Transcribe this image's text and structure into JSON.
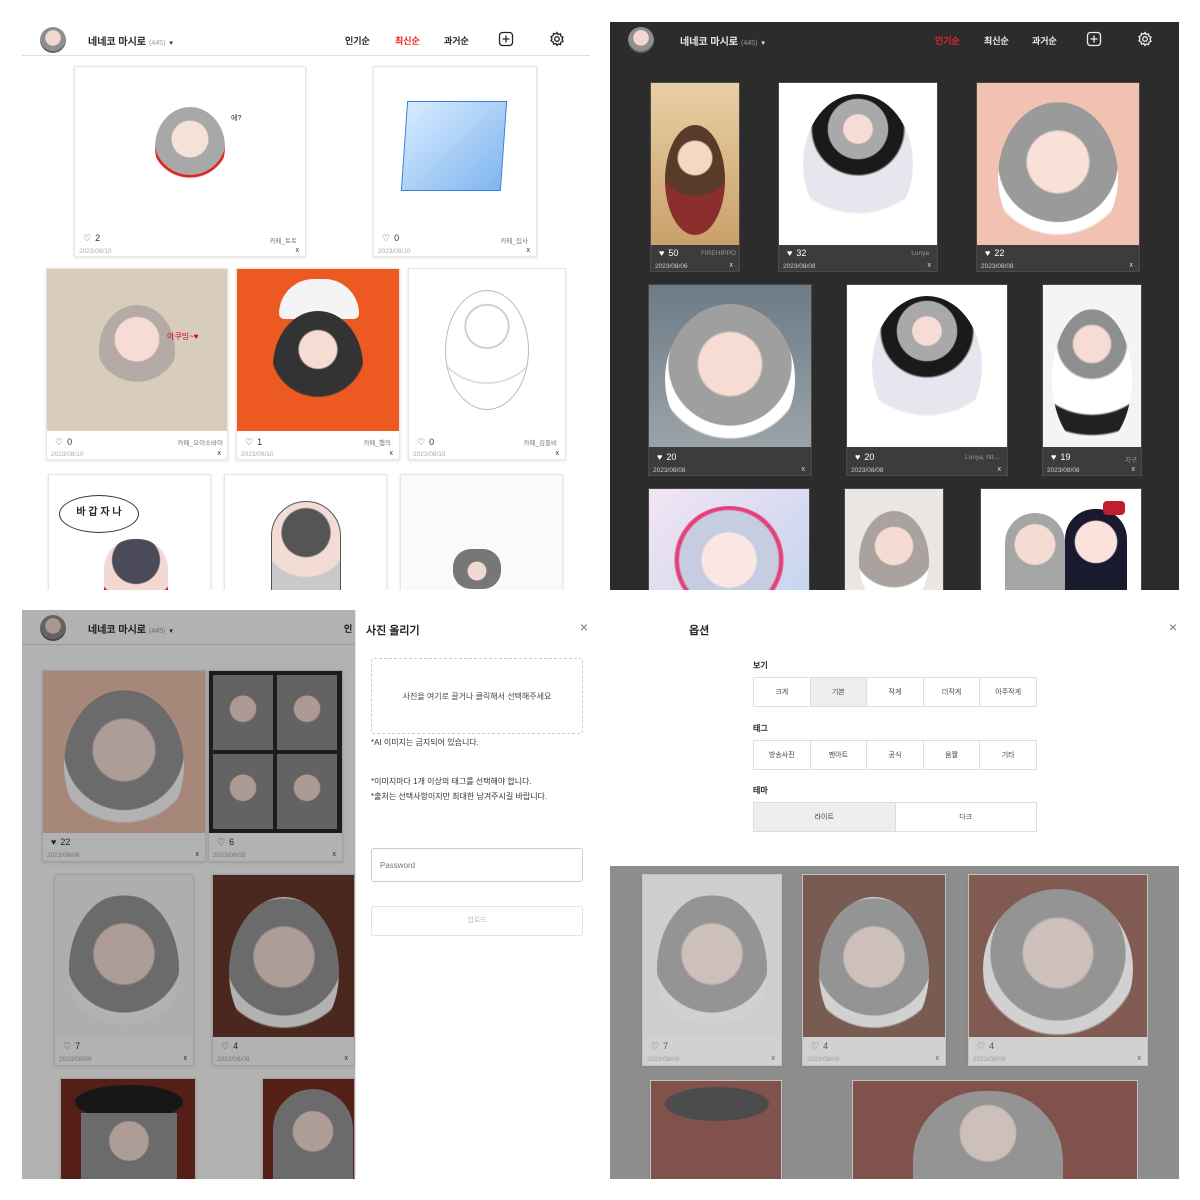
{
  "header": {
    "username": "네네코 마시로",
    "count": "(445)",
    "caret": "▾",
    "tabs": [
      "인기순",
      "최신순",
      "과거순"
    ]
  },
  "light_feed": {
    "active_tab": "최신순",
    "cards": [
      {
        "likes": "2",
        "date": "2023/08/10",
        "author": "카페_토토",
        "close": "x"
      },
      {
        "likes": "0",
        "date": "2023/08/10",
        "author": "카페_집사",
        "close": "x"
      },
      {
        "likes": "0",
        "date": "2023/08/10",
        "author": "카페_오이소바이",
        "close": "x"
      },
      {
        "likes": "1",
        "date": "2023/08/10",
        "author": "카페_햄의",
        "close": "x"
      },
      {
        "likes": "0",
        "date": "2023/08/10",
        "author": "카페_김들비",
        "close": "x"
      }
    ],
    "art_text": {
      "bubble_a": "에?",
      "bubble_b": "아쿠밍~♥",
      "bubble_c": "바 갑 자 나"
    }
  },
  "dark_feed": {
    "active_tab": "인기순",
    "cards": [
      {
        "likes": "50",
        "date": "2023/08/06",
        "author": "FIREHIPPO",
        "close": "x"
      },
      {
        "likes": "32",
        "date": "2023/08/08",
        "author": "Lunya",
        "close": "x"
      },
      {
        "likes": "22",
        "date": "2023/08/08",
        "author": "",
        "close": "x"
      },
      {
        "likes": "20",
        "date": "2023/08/08",
        "author": "",
        "close": "x"
      },
      {
        "likes": "20",
        "date": "2023/08/08",
        "author": "Lunya, htt...",
        "close": "x"
      },
      {
        "likes": "19",
        "date": "2023/08/08",
        "author": "지구",
        "close": "x"
      }
    ]
  },
  "upload_screen": {
    "partial_tab": "인",
    "background_cards": [
      {
        "likes": "22",
        "date": "2023/08/08",
        "close": "x"
      },
      {
        "likes": "6",
        "date": "2023/08/08",
        "close": "x"
      },
      {
        "likes": "7",
        "date": "2023/08/08",
        "close": "x"
      },
      {
        "likes": "4",
        "date": "2023/08/08",
        "close": "x"
      }
    ],
    "panel": {
      "title": "사진 올리기",
      "close": "×",
      "dropzone": "사진을 여기로 끌거나 클릭해서 선택해주세요",
      "note_ai": "*AI 이미지는 금지되어 있습니다.",
      "note_tag": "*이미지마다 1개 이상의 태그를 선택해야 합니다.",
      "note_source": "*출처는 선택사항이지만 최대한 남겨주시길 바랍니다.",
      "password_placeholder": "Password",
      "upload_button": "업로드"
    }
  },
  "options_screen": {
    "title": "옵션",
    "close": "×",
    "view_label": "보기",
    "view_options": [
      "크게",
      "기본",
      "작게",
      "더작게",
      "아주작게"
    ],
    "view_selected": "기본",
    "tag_label": "태그",
    "tag_options": [
      "방송사진",
      "팬아트",
      "공식",
      "움짤",
      "기타"
    ],
    "theme_label": "테마",
    "theme_options": [
      "라이트",
      "다크"
    ],
    "theme_selected": "라이트",
    "background_cards": [
      {
        "likes": "7",
        "date": "2023/08/08",
        "close": "x"
      },
      {
        "likes": "4",
        "date": "2023/08/08",
        "close": "x"
      },
      {
        "likes": "4",
        "date": "2023/08/08",
        "close": "x"
      }
    ]
  },
  "colors": {
    "accent": "#ee2222",
    "dark_bg": "#2c2c2c",
    "card_dark": "#3c3c3c"
  },
  "icons": {
    "like": "heart-icon",
    "add": "plus-square-icon",
    "settings": "gear-icon",
    "close": "close-icon"
  }
}
